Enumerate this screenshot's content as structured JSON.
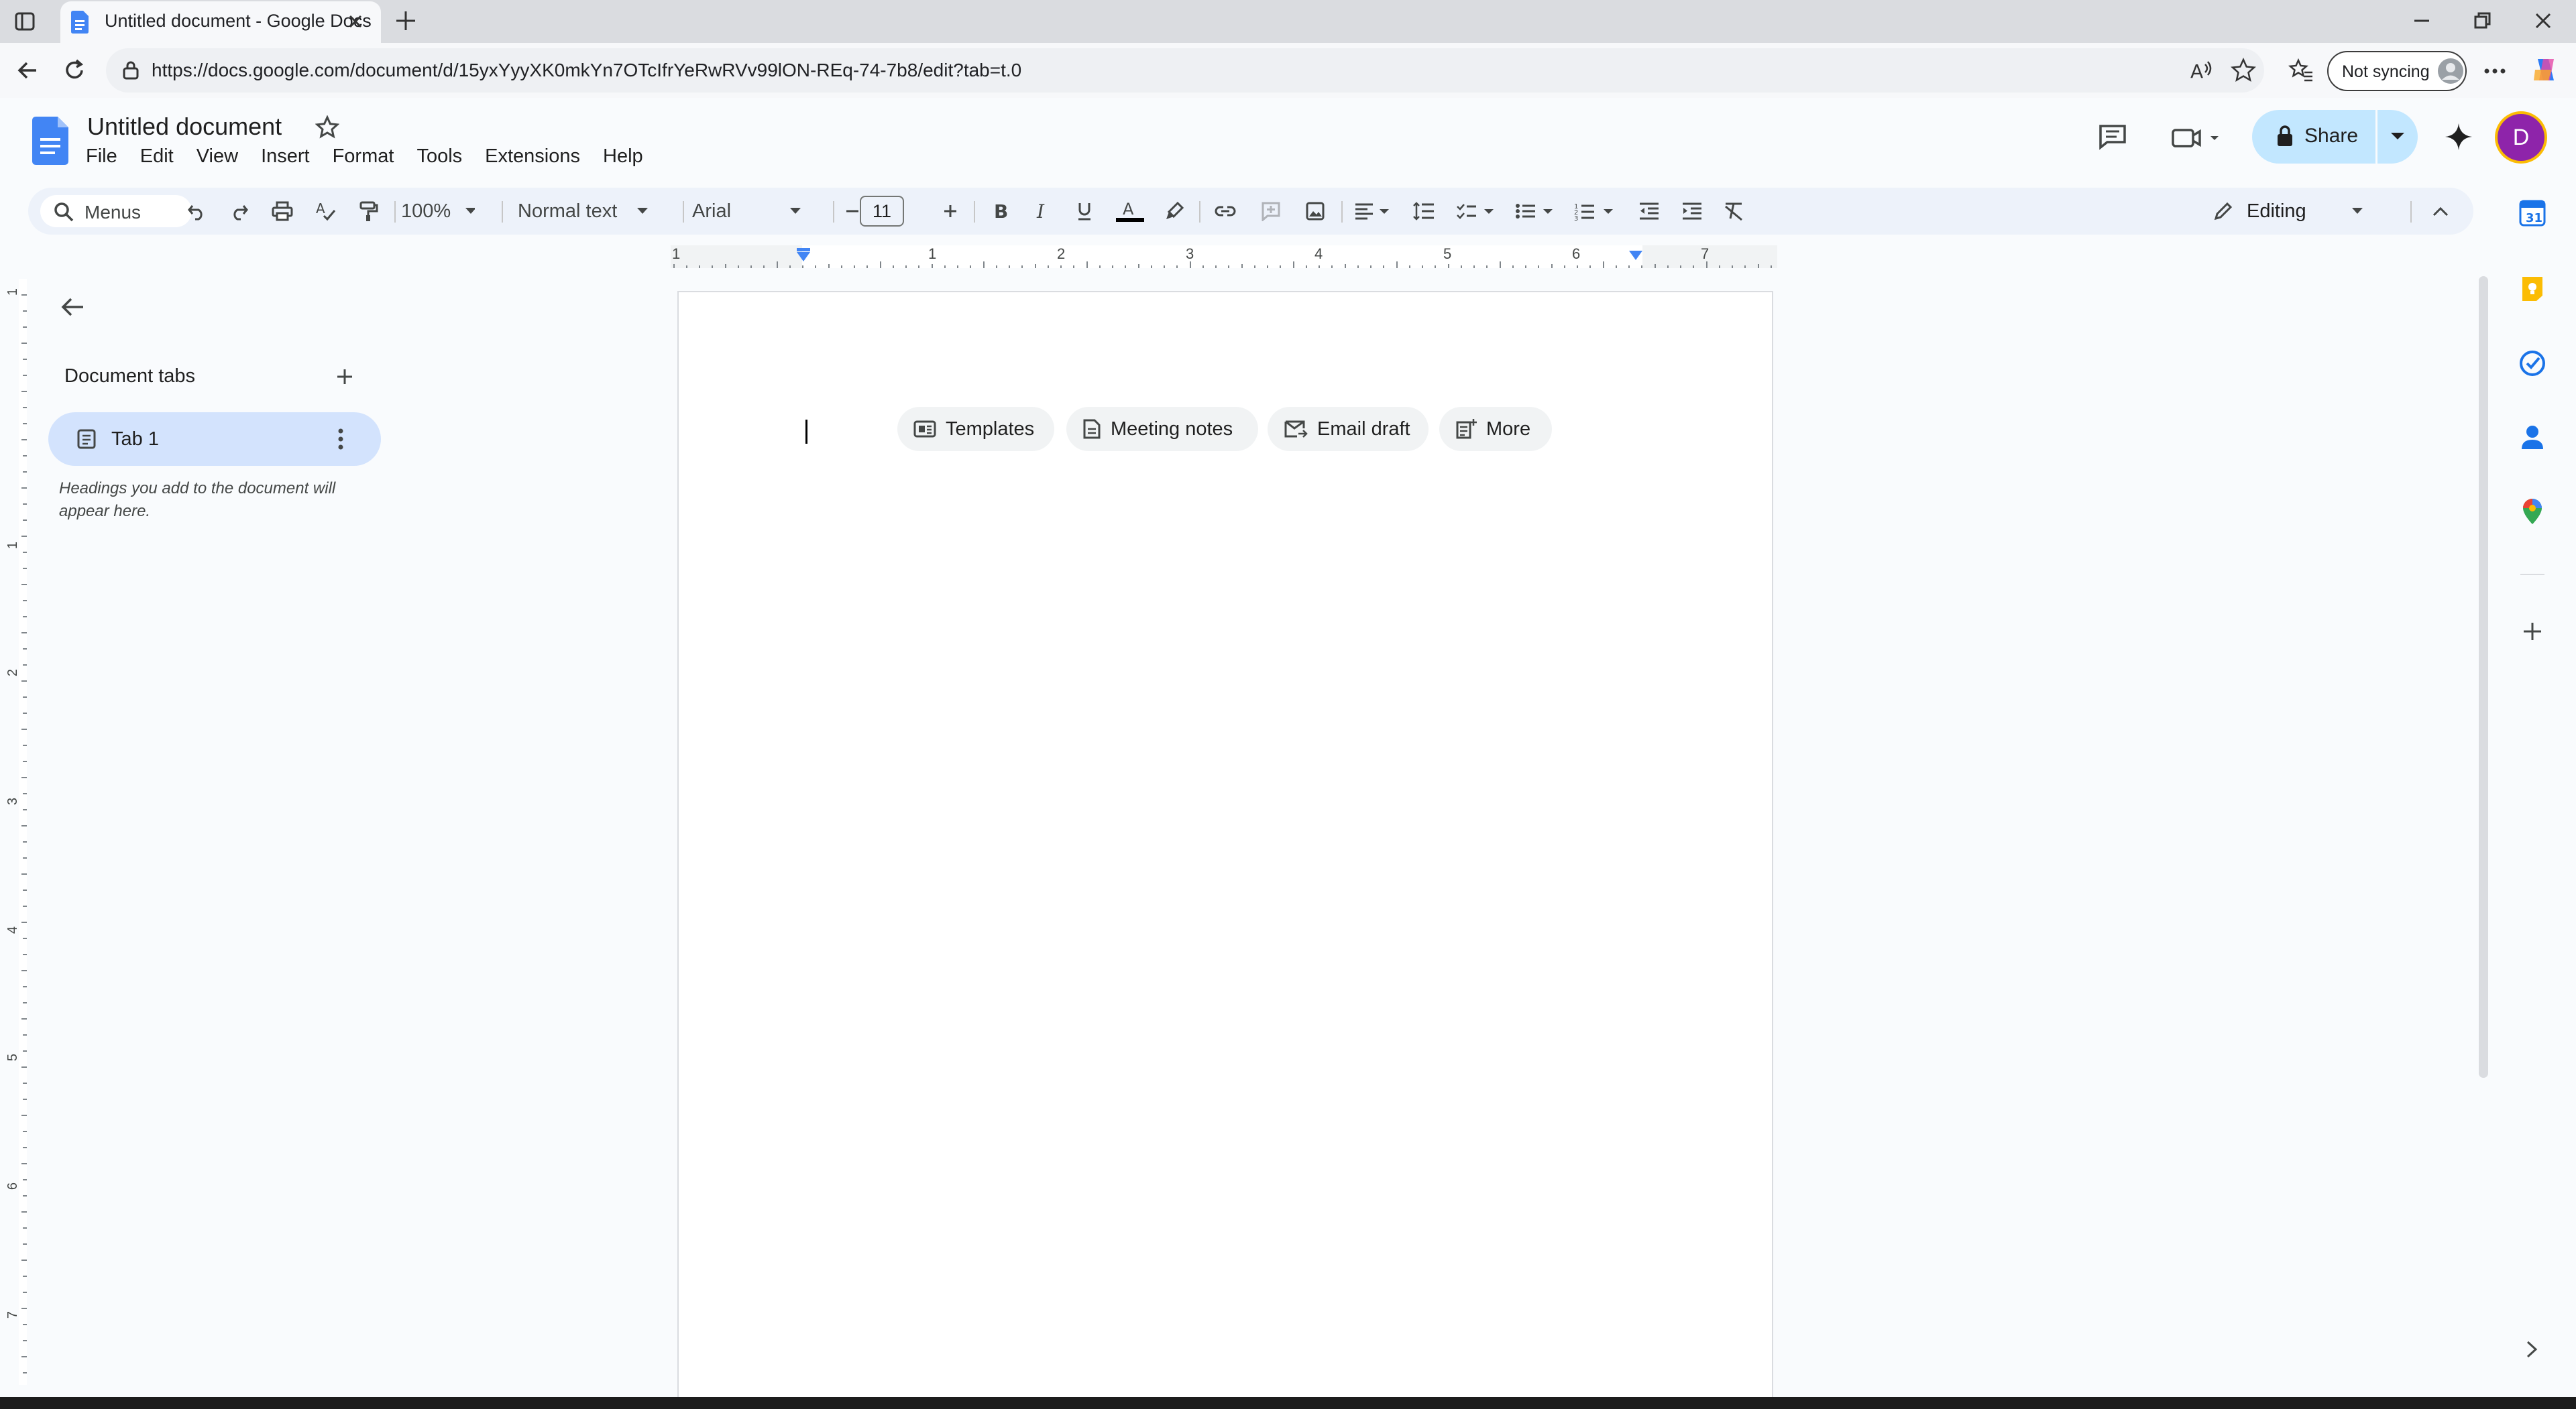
{
  "browser": {
    "tab_title": "Untitled document - Google Docs",
    "url": "https://docs.google.com/document/d/15yxYyyXK0mkYn7OTcIfrYeRwRVv99lON-REq-74-7b8/edit?tab=t.0",
    "sync_label": "Not syncing"
  },
  "doc": {
    "title": "Untitled document",
    "menus": [
      "File",
      "Edit",
      "View",
      "Insert",
      "Format",
      "Tools",
      "Extensions",
      "Help"
    ],
    "share_label": "Share",
    "avatar_letter": "D"
  },
  "toolbar": {
    "search_label": "Menus",
    "zoom": "100%",
    "style": "Normal text",
    "font": "Arial",
    "font_size": "11",
    "mode": "Editing",
    "colors": {
      "text_underline": "#000000",
      "accent": "#0b57d0"
    }
  },
  "ruler": {
    "h_labels": [
      "1",
      "1",
      "2",
      "3",
      "4",
      "5",
      "6",
      "7"
    ],
    "v_labels": [
      "1",
      "1",
      "2",
      "3",
      "4",
      "5",
      "6",
      "7"
    ]
  },
  "sidebar": {
    "heading": "Document tabs",
    "tabs": [
      {
        "label": "Tab 1"
      }
    ],
    "hint": "Headings you add to the document will appear here."
  },
  "page": {
    "chips": [
      {
        "label": "Templates",
        "icon": "templates-icon"
      },
      {
        "label": "Meeting notes",
        "icon": "document-icon"
      },
      {
        "label": "Email draft",
        "icon": "email-icon"
      },
      {
        "label": "More",
        "icon": "more-icon"
      }
    ]
  },
  "side_apps": [
    "calendar-icon",
    "keep-icon",
    "tasks-icon",
    "contacts-icon",
    "maps-icon",
    "add-icon"
  ]
}
